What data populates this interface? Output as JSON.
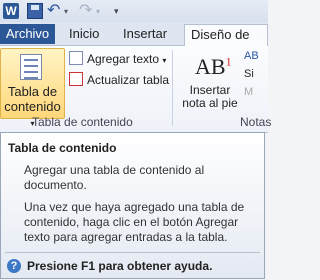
{
  "qat": {
    "app_icon": "W"
  },
  "tabs": [
    "Archivo",
    "Inicio",
    "Insertar",
    "Diseño de pági"
  ],
  "ribbon": {
    "toc_button": {
      "line1": "Tabla de",
      "line2": "contenido",
      "arrow": "▾"
    },
    "add_text": "Agregar texto",
    "update_table": "Actualizar tabla",
    "group1_label": "Tabla de contenido",
    "insert_footnote": {
      "line1": "Insertar",
      "line2": "nota al pie"
    },
    "footnote_icon": {
      "text": "AB",
      "sup": "1"
    },
    "group2_label": "Notas",
    "partial_items": [
      "AB",
      "Si",
      "M"
    ]
  },
  "tooltip": {
    "title": "Tabla de contenido",
    "p1": "Agregar una tabla de contenido al documento.",
    "p2": "Una vez que haya agregado una tabla de contenido, haga clic en el botón Agregar texto para agregar entradas a la tabla.",
    "help": "Presione F1 para obtener ayuda."
  }
}
